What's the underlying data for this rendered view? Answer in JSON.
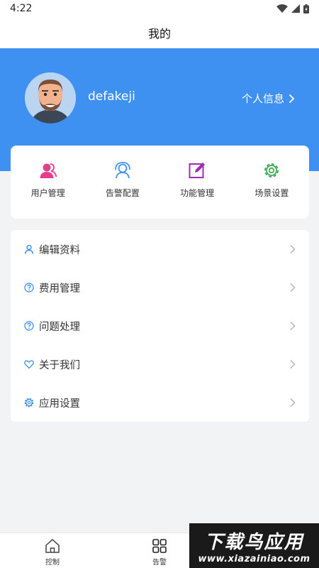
{
  "status_bar": {
    "time": "4:22"
  },
  "header": {
    "title": "我的"
  },
  "profile": {
    "username": "defakeji",
    "info_link": "个人信息"
  },
  "quick_actions": [
    {
      "label": "用户管理",
      "icon": "users-icon",
      "color": "#e0418a"
    },
    {
      "label": "告警配置",
      "icon": "alarm-user-icon",
      "color": "#3e91f0"
    },
    {
      "label": "功能管理",
      "icon": "edit-icon",
      "color": "#9c2fb0"
    },
    {
      "label": "场景设置",
      "icon": "gear-icon",
      "color": "#3fae57"
    }
  ],
  "menu": [
    {
      "label": "编辑资料",
      "icon": "user-icon"
    },
    {
      "label": "费用管理",
      "icon": "question-circle-icon"
    },
    {
      "label": "问题处理",
      "icon": "question-circle-icon"
    },
    {
      "label": "关于我们",
      "icon": "heart-icon"
    },
    {
      "label": "应用设置",
      "icon": "gear-icon"
    }
  ],
  "tabs": [
    {
      "label": "控制",
      "icon": "home-icon"
    },
    {
      "label": "告警",
      "icon": "grid-icon"
    }
  ],
  "watermark": {
    "title": "下载鸟应用",
    "url": "www.xiazainiao.com"
  },
  "colors": {
    "accent": "#3e91f0",
    "menu_icon": "#2f86e8"
  }
}
